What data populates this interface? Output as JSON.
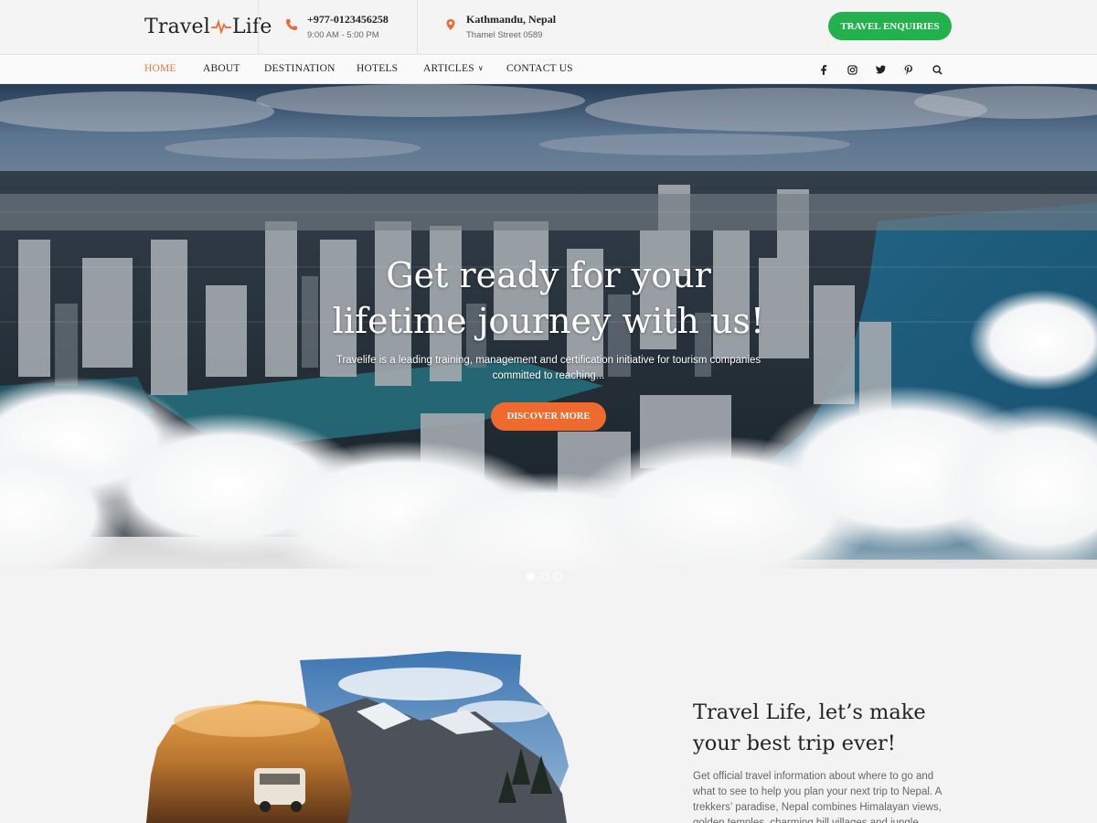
{
  "brand": {
    "logo_left": "Travel",
    "logo_right": "Life"
  },
  "header": {
    "phone": {
      "number": "+977-0123456258",
      "hours": "9:00 AM - 5:00 PM",
      "icon": "phone-icon"
    },
    "location": {
      "city": "Kathmandu, Nepal",
      "street": "Thamel Street 0589",
      "icon": "location-pin-icon"
    },
    "cta": "TRAVEL ENQUIRIES"
  },
  "nav": {
    "items": [
      {
        "label": "HOME"
      },
      {
        "label": "ABOUT"
      },
      {
        "label": "DESTINATION"
      },
      {
        "label": "HOTELS"
      },
      {
        "label": "ARTICLES"
      },
      {
        "label": "CONTACT US"
      }
    ],
    "social": [
      "facebook-icon",
      "instagram-icon",
      "twitter-icon",
      "pinterest-icon",
      "search-icon"
    ]
  },
  "hero": {
    "title_line1": "Get ready for your",
    "title_line2": "lifetime journey with us!",
    "subtitle": "Travelife is a leading training, management and certification initiative for tourism companies committed to reaching...",
    "button": "DISCOVER MORE",
    "slides": 3,
    "active_slide": 1
  },
  "about": {
    "title_line1": "Travel Life, let’s make",
    "title_line2": "your best trip ever!",
    "text": "Get official travel information about where to go and what to see to help you plan your next trip to Nepal. A trekkers’ paradise, Nepal combines Himalayan views, golden temples, charming hill villages and jungle"
  },
  "colors": {
    "accent": "#e8763e",
    "discover_button": "#ef6a2e",
    "cta_green": "#22b14c"
  }
}
